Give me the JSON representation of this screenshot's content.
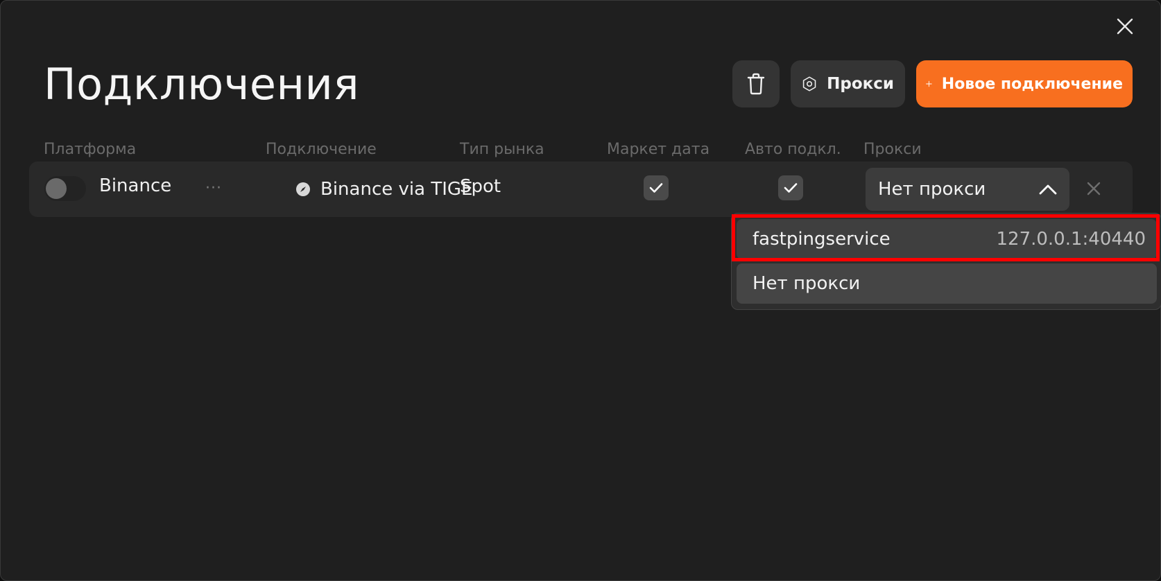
{
  "dialog": {
    "title": "Подключения",
    "close_icon": "close-icon"
  },
  "toolbar": {
    "delete_icon": "trash-icon",
    "proxy_label": "Прокси",
    "proxy_icon": "hexagon-icon",
    "new_label": "Новое подключение",
    "new_icon": "plus-icon",
    "accent": "#f86f1f"
  },
  "columns": [
    "Платформа",
    "Подключение",
    "Тип рынка",
    "Маркет дата",
    "Авто подкл.",
    "Прокси"
  ],
  "row": {
    "platform": "Binance",
    "enabled": false,
    "more": "···",
    "connection": "Binance via TIGER",
    "market_type": "Spot",
    "market_data": true,
    "auto_connect": true,
    "proxy": "Нет прокси"
  },
  "dropdown": {
    "options": [
      {
        "name": "fastpingservice",
        "address": "127.0.0.1:40440"
      },
      {
        "name": "Нет прокси",
        "address": ""
      }
    ],
    "highlight_color": "#ff0000"
  }
}
